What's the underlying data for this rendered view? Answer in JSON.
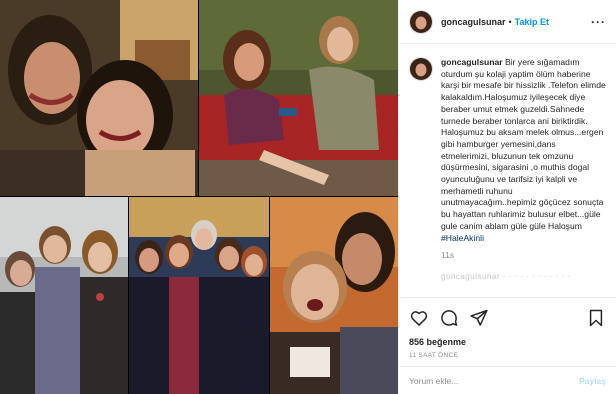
{
  "post": {
    "username": "goncagulsunar",
    "dot": "•",
    "follow_label": "Takip Et",
    "more_label": "···"
  },
  "caption": {
    "username": "goncagulsunar",
    "text": "Bir yere sığamadım oturdum şu kolaji yaptim ölüm haberine karşi bir mesafe bir hissizlik .Telefon elimde kalakaldım.Haloşumuz iyileşecek diye beraber umut etmek guzeldi.Sahnede turnede beraber tonlarca ani biriktirdik. Haloşumuz bu aksam melek olmus...ergen gibi hamburger yemesini,dans etmelerimizi, bluzunun tek omzunu düşürmesini, sigarasini ,o muthis dogal oyunculuğunu ve tarifsiz iyi kalpli ve merhametli ruhunu unutmayacağım..hepimiz göçücez sonuçta bu hayattan ruhlarimiz bulusur elbet...güle gule canim ablam güle güle Haloşum",
    "hashtag": "#HaleAkinli",
    "time": "11s"
  },
  "faded_comment": "goncagulsunar · · · · · · · · · · · ·",
  "likes": "856 beğenme",
  "posted_ago": "11 SAAT ÖNCE",
  "comment_input": {
    "placeholder": "Yorum ekle...",
    "post_label": "Paylaş"
  },
  "icons": {
    "like": "heart-icon",
    "comment": "comment-icon",
    "share": "share-icon",
    "save": "bookmark-icon"
  },
  "colors": {
    "link_blue": "#0095f6",
    "post_disabled": "#b2dffc",
    "hashtag": "#003569"
  }
}
